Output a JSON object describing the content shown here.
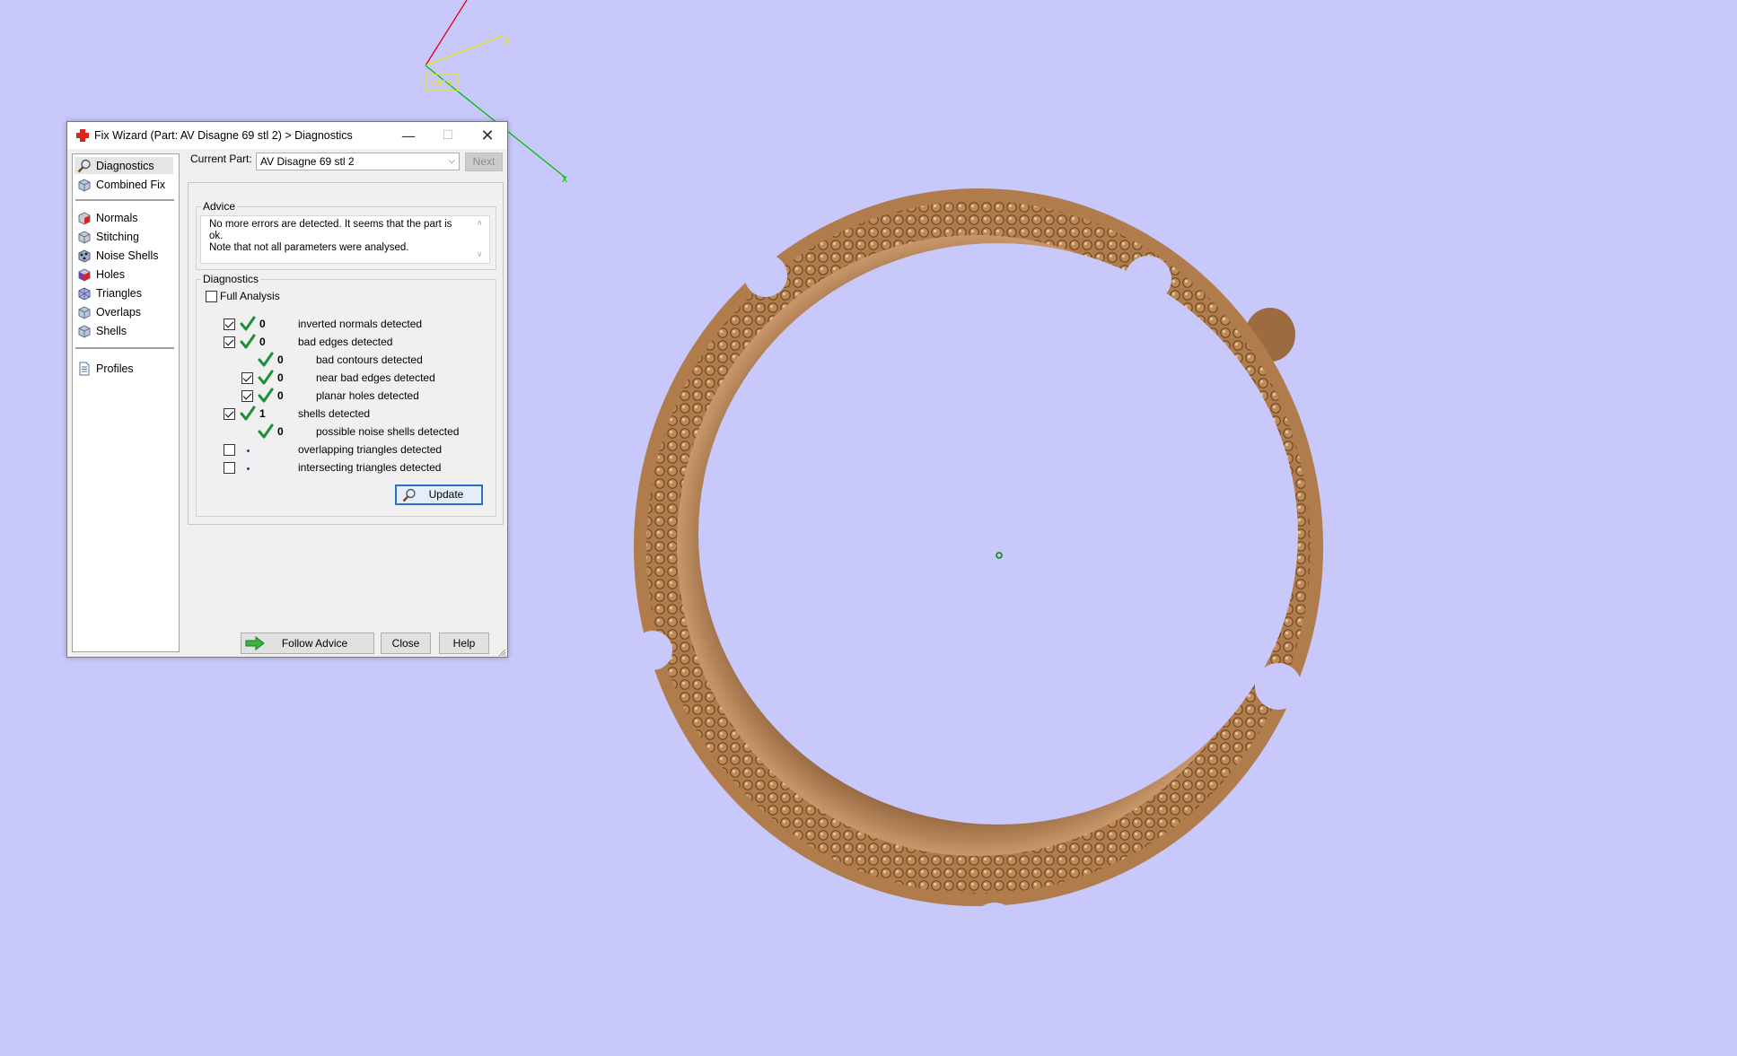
{
  "dialog": {
    "title": "Fix Wizard (Part: AV Disagne 69 stl 2) > Diagnostics",
    "window_buttons": [
      "minimize-icon",
      "maximize-icon",
      "close-icon"
    ],
    "sidebar": {
      "top_items": [
        {
          "label": "Diagnostics",
          "icon": "magnifier-icon",
          "selected": true
        },
        {
          "label": "Combined Fix",
          "icon": "cube-icon"
        }
      ],
      "fix_items": [
        {
          "label": "Normals",
          "icon": "normals-cube-icon"
        },
        {
          "label": "Stitching",
          "icon": "stitching-cube-icon"
        },
        {
          "label": "Noise Shells",
          "icon": "noise-shells-icon"
        },
        {
          "label": "Holes",
          "icon": "holes-cube-icon"
        },
        {
          "label": "Triangles",
          "icon": "triangles-cube-icon"
        },
        {
          "label": "Overlaps",
          "icon": "overlaps-cube-icon"
        },
        {
          "label": "Shells",
          "icon": "shells-cube-icon"
        }
      ],
      "bottom_items": [
        {
          "label": "Profiles",
          "icon": "document-icon"
        }
      ]
    },
    "current_part_label": "Current Part:",
    "current_part_value": "AV Disagne 69 stl 2",
    "next_label": "Next",
    "advice": {
      "title": "Advice",
      "line1": "No more errors are detected. It seems that the part is ok.",
      "line2": "Note that not all parameters were analysed."
    },
    "diagnostics": {
      "title": "Diagnostics",
      "full_analysis_label": "Full Analysis",
      "full_analysis_checked": false,
      "rows": [
        {
          "checkbox": true,
          "checked": true,
          "status": "ok",
          "value": "0",
          "label": "inverted normals detected",
          "indent": 0
        },
        {
          "checkbox": true,
          "checked": true,
          "status": "ok",
          "value": "0",
          "label": "bad edges detected",
          "indent": 0
        },
        {
          "checkbox": false,
          "checked": false,
          "status": "ok",
          "value": "0",
          "label": "bad contours detected",
          "indent": 1
        },
        {
          "checkbox": true,
          "checked": true,
          "status": "ok",
          "value": "0",
          "label": "near bad edges detected",
          "indent": 1
        },
        {
          "checkbox": true,
          "checked": true,
          "status": "ok",
          "value": "0",
          "label": "planar holes detected",
          "indent": 1
        },
        {
          "checkbox": true,
          "checked": true,
          "status": "ok",
          "value": "1",
          "label": "shells detected",
          "indent": 0
        },
        {
          "checkbox": false,
          "checked": false,
          "status": "ok",
          "value": "0",
          "label": "possible noise shells detected",
          "indent": 1
        },
        {
          "checkbox": true,
          "checked": false,
          "status": "pending",
          "value": "",
          "label": "overlapping triangles detected",
          "indent": 0
        },
        {
          "checkbox": true,
          "checked": false,
          "status": "pending",
          "value": "",
          "label": "intersecting triangles detected",
          "indent": 0
        }
      ],
      "update_label": "Update"
    },
    "buttons": {
      "follow_advice": "Follow Advice",
      "close": "Close",
      "help": "Help"
    }
  },
  "viewport": {
    "background": "#c8c8fa",
    "axes": {
      "x_label": "x",
      "y_label": "y",
      "wcs_label": "WCS",
      "x_color": "#00c000",
      "y_color": "#e6e600",
      "z_color": "#e00000"
    },
    "model": "gold filigree ring with beaded band",
    "ring_color": "#b07c4c"
  },
  "colors": {
    "tick_green": "#1f8f3a",
    "dot_blue": "#2b2bd6",
    "accent_red": "#d8261b"
  }
}
